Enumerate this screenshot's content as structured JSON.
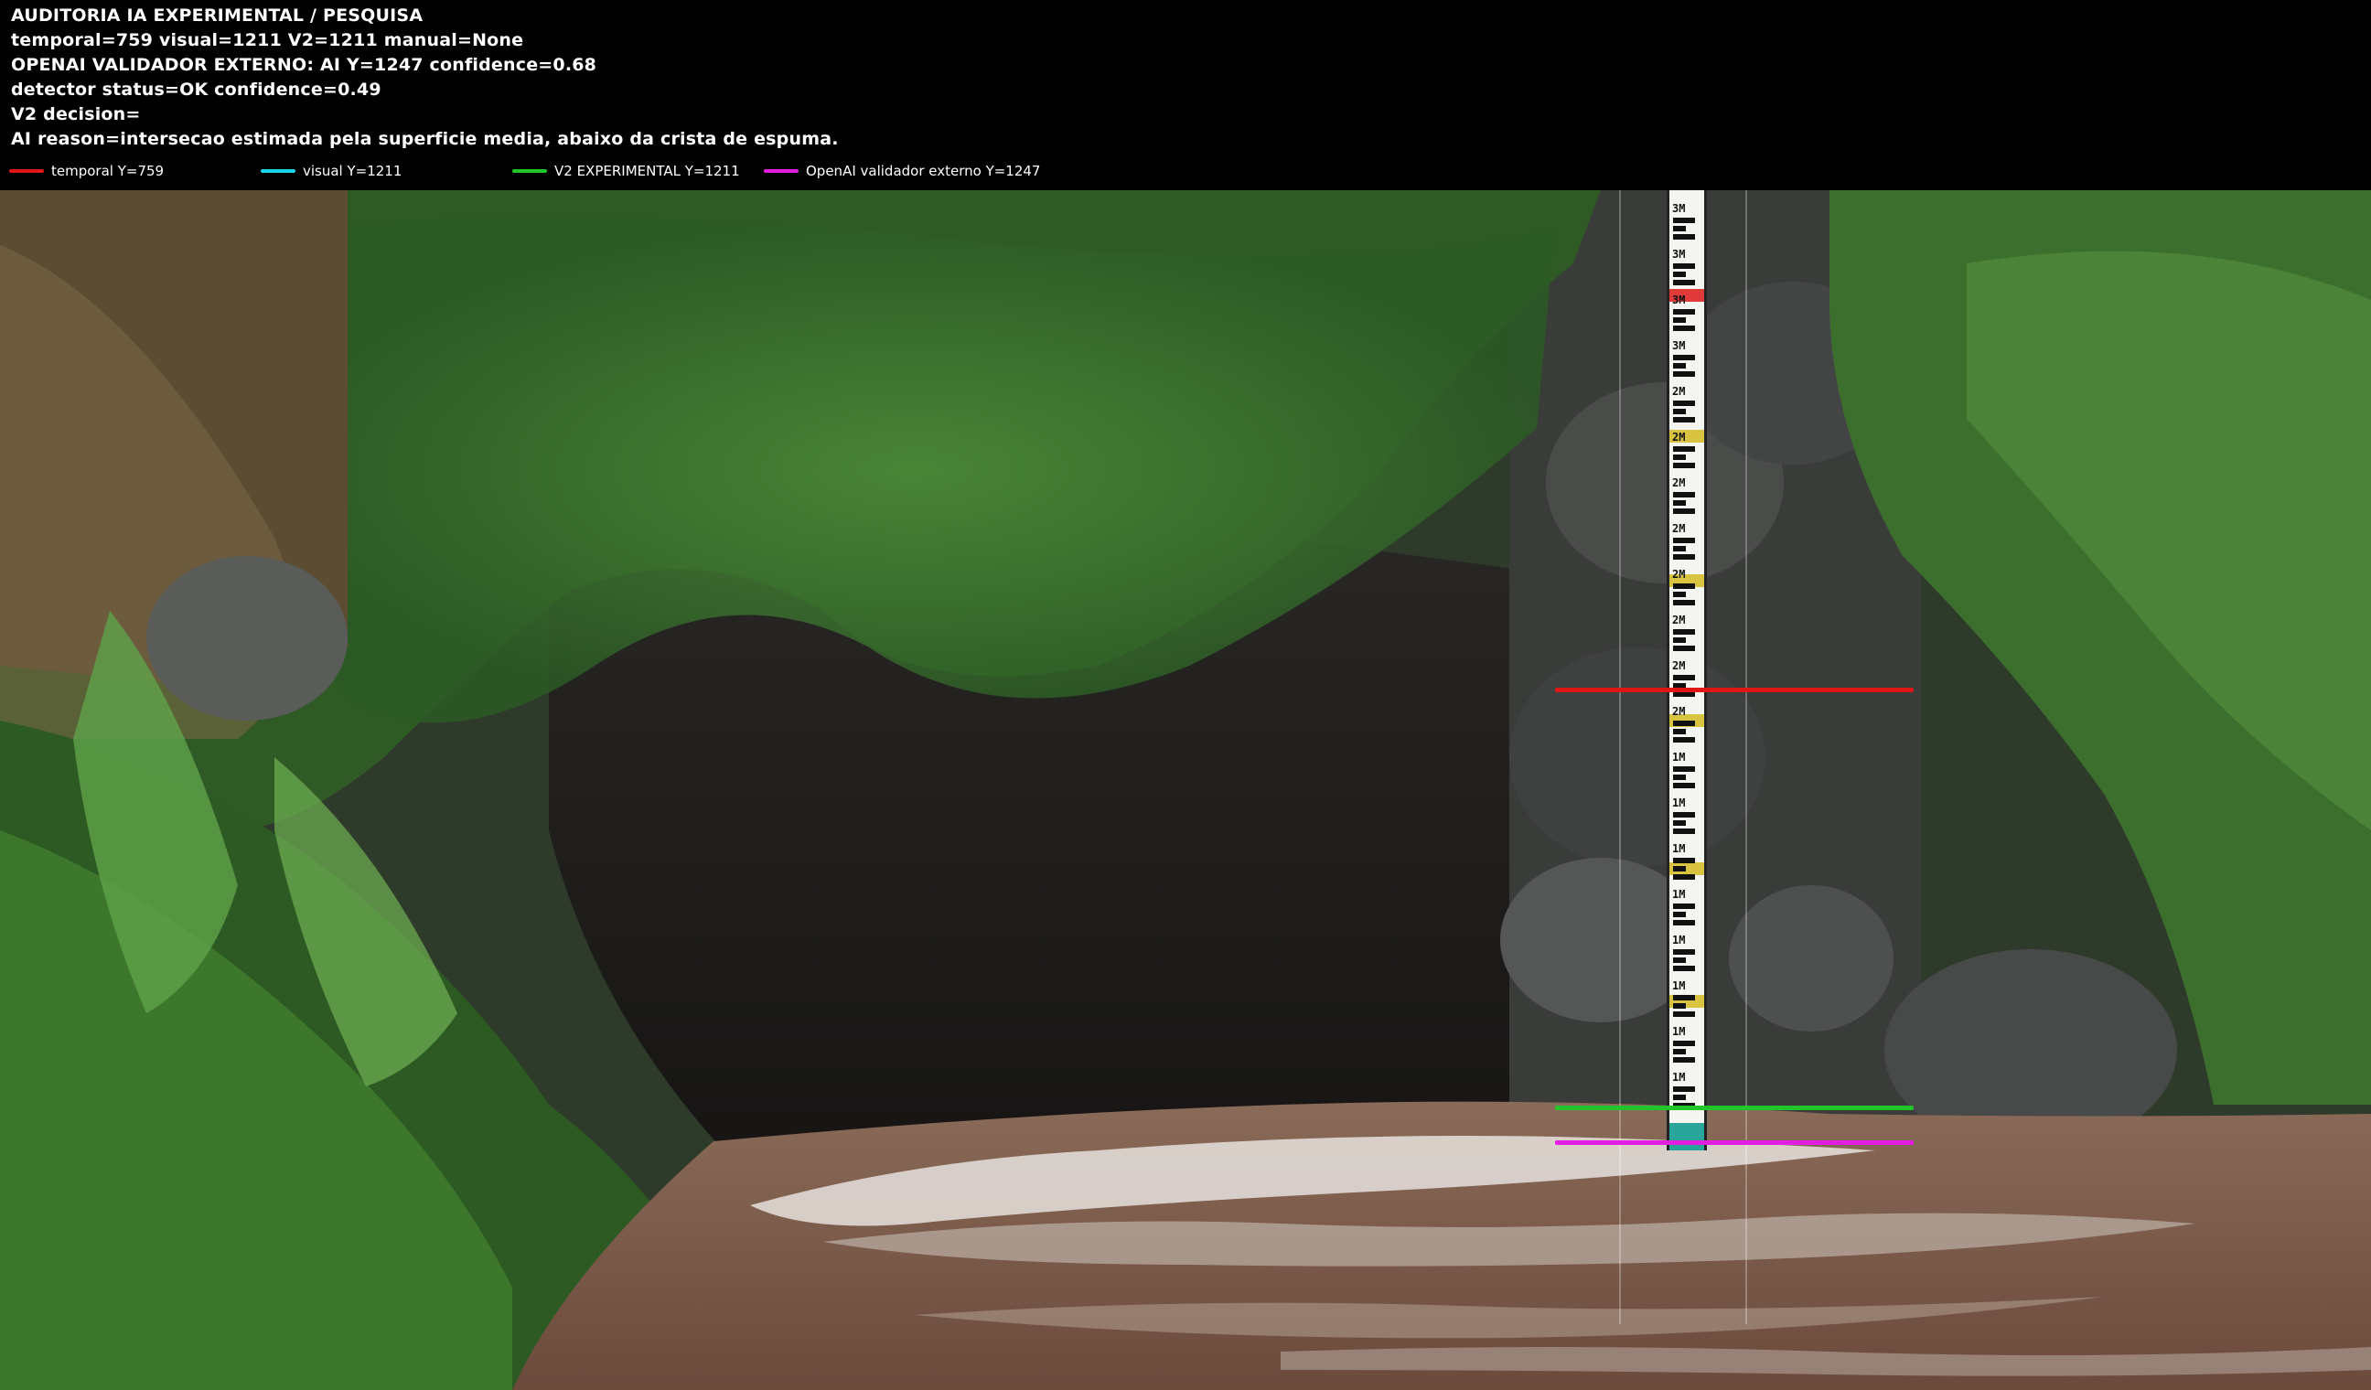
{
  "header": {
    "lines": [
      "AUDITORIA IA  EXPERIMENTAL / PESQUISA",
      "temporal=759  visual=1211  V2=1211  manual=None",
      "OPENAI  VALIDADOR EXTERNO: AI Y=1247  confidence=0.68",
      "detector status=OK confidence=0.49",
      "V2 decision=",
      "AI reason=intersecao estimada pela superficie media, abaixo da crista de espuma."
    ]
  },
  "legend": [
    {
      "label": "temporal Y=759",
      "color": "#e01515"
    },
    {
      "label": "visual Y=1211",
      "color": "#19d6e6"
    },
    {
      "label": "V2 EXPERIMENTAL Y=1211",
      "color": "#22c52a"
    },
    {
      "label": "OpenAI validador externo Y=1247",
      "color": "#e21ee0"
    }
  ],
  "markers": [
    {
      "name": "temporal",
      "color": "#e01515"
    },
    {
      "name": "v2-experimental",
      "color": "#22c52a"
    },
    {
      "name": "openai-validator",
      "color": "#e21ee0"
    }
  ],
  "gauge_labels": [
    "3M",
    "3M",
    "3M",
    "3M",
    "2M",
    "2M",
    "2M",
    "2M",
    "2M",
    "2M",
    "2M",
    "2M",
    "1M",
    "1M",
    "1M",
    "1M",
    "1M",
    "1M",
    "1M",
    "1M"
  ]
}
